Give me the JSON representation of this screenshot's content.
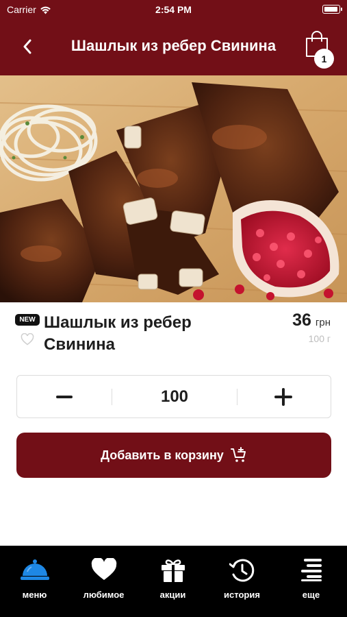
{
  "status_bar": {
    "carrier": "Carrier",
    "time": "2:54 PM",
    "battery_level": 0.95
  },
  "nav": {
    "title": "Шашлык из ребер Свинина",
    "back_icon": "chevron-left-icon",
    "cart_icon": "shopping-bag-icon",
    "cart_count": "1"
  },
  "product": {
    "badge": "NEW",
    "name": "Шашлык из ребер Свинина",
    "price": "36",
    "currency": "грн",
    "weight": "100 г",
    "favorite_icon": "heart-outline-icon",
    "image": "grilled-pork-ribs-photo"
  },
  "stepper": {
    "value": "100"
  },
  "add_to_cart": {
    "label": "Добавить в корзину",
    "icon": "cart-plus-icon"
  },
  "tabs": [
    {
      "label": "меню",
      "icon": "cloche-icon",
      "active": true
    },
    {
      "label": "любимое",
      "icon": "heart-icon",
      "active": false
    },
    {
      "label": "акции",
      "icon": "gift-icon",
      "active": false
    },
    {
      "label": "история",
      "icon": "history-clock-icon",
      "active": false
    },
    {
      "label": "еще",
      "icon": "more-lines-icon",
      "active": false
    }
  ],
  "colors": {
    "brand": "#720f17",
    "tab_bar": "#000000",
    "active_tab_icon": "#1e88e5",
    "price_muted": "#bdbdbd"
  }
}
